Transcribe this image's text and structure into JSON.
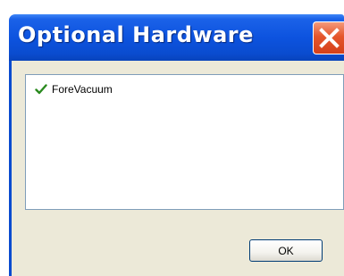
{
  "window": {
    "title": "Optional Hardware",
    "close_icon": "close-icon"
  },
  "hardware_list": {
    "items": [
      {
        "label": "ForeVacuum",
        "checked": true,
        "icon": "checkmark-icon"
      }
    ]
  },
  "buttons": {
    "ok_label": "OK"
  },
  "colors": {
    "titlebar": "#0d53df",
    "close_button": "#e5562c",
    "dialog_background": "#ece9d8",
    "check_green": "#2a8a1f"
  }
}
